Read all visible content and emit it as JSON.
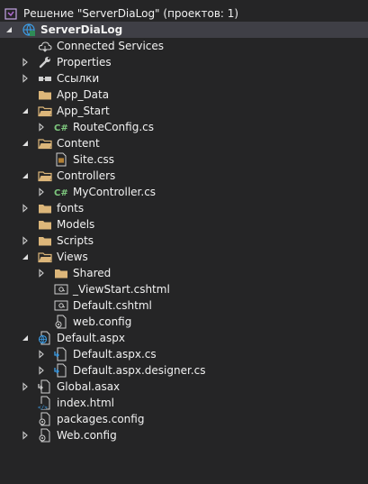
{
  "solution": {
    "label": "Решение \"ServerDiaLog\"  (проектов: 1)",
    "icon": "solution-icon"
  },
  "project": {
    "label": "ServerDiaLog",
    "icon": "web-project-icon"
  },
  "nodes": [
    {
      "label": "Connected Services",
      "icon": "cloud-icon"
    },
    {
      "label": "Properties",
      "icon": "wrench-icon"
    },
    {
      "label": "Ссылки",
      "icon": "references-icon"
    },
    {
      "label": "App_Data",
      "icon": "folder-icon"
    },
    {
      "label": "App_Start",
      "icon": "folder-icon"
    },
    {
      "label": "RouteConfig.cs",
      "icon": "csharp-file-icon"
    },
    {
      "label": "Content",
      "icon": "folder-icon"
    },
    {
      "label": "Site.css",
      "icon": "css-file-icon"
    },
    {
      "label": "Controllers",
      "icon": "folder-icon"
    },
    {
      "label": "MyController.cs",
      "icon": "csharp-file-icon"
    },
    {
      "label": "fonts",
      "icon": "folder-icon"
    },
    {
      "label": "Models",
      "icon": "folder-icon"
    },
    {
      "label": "Scripts",
      "icon": "folder-icon"
    },
    {
      "label": "Views",
      "icon": "folder-icon"
    },
    {
      "label": "Shared",
      "icon": "folder-icon"
    },
    {
      "label": "_ViewStart.cshtml",
      "icon": "razor-file-icon"
    },
    {
      "label": "Default.cshtml",
      "icon": "razor-file-icon"
    },
    {
      "label": "web.config",
      "icon": "config-file-icon"
    },
    {
      "label": "Default.aspx",
      "icon": "aspx-file-icon"
    },
    {
      "label": "Default.aspx.cs",
      "icon": "code-file-icon"
    },
    {
      "label": "Default.aspx.designer.cs",
      "icon": "code-file-icon"
    },
    {
      "label": "Global.asax",
      "icon": "code-file-icon"
    },
    {
      "label": "index.html",
      "icon": "html-file-icon"
    },
    {
      "label": "packages.config",
      "icon": "config-file-icon"
    },
    {
      "label": "Web.config",
      "icon": "config-file-icon"
    }
  ]
}
